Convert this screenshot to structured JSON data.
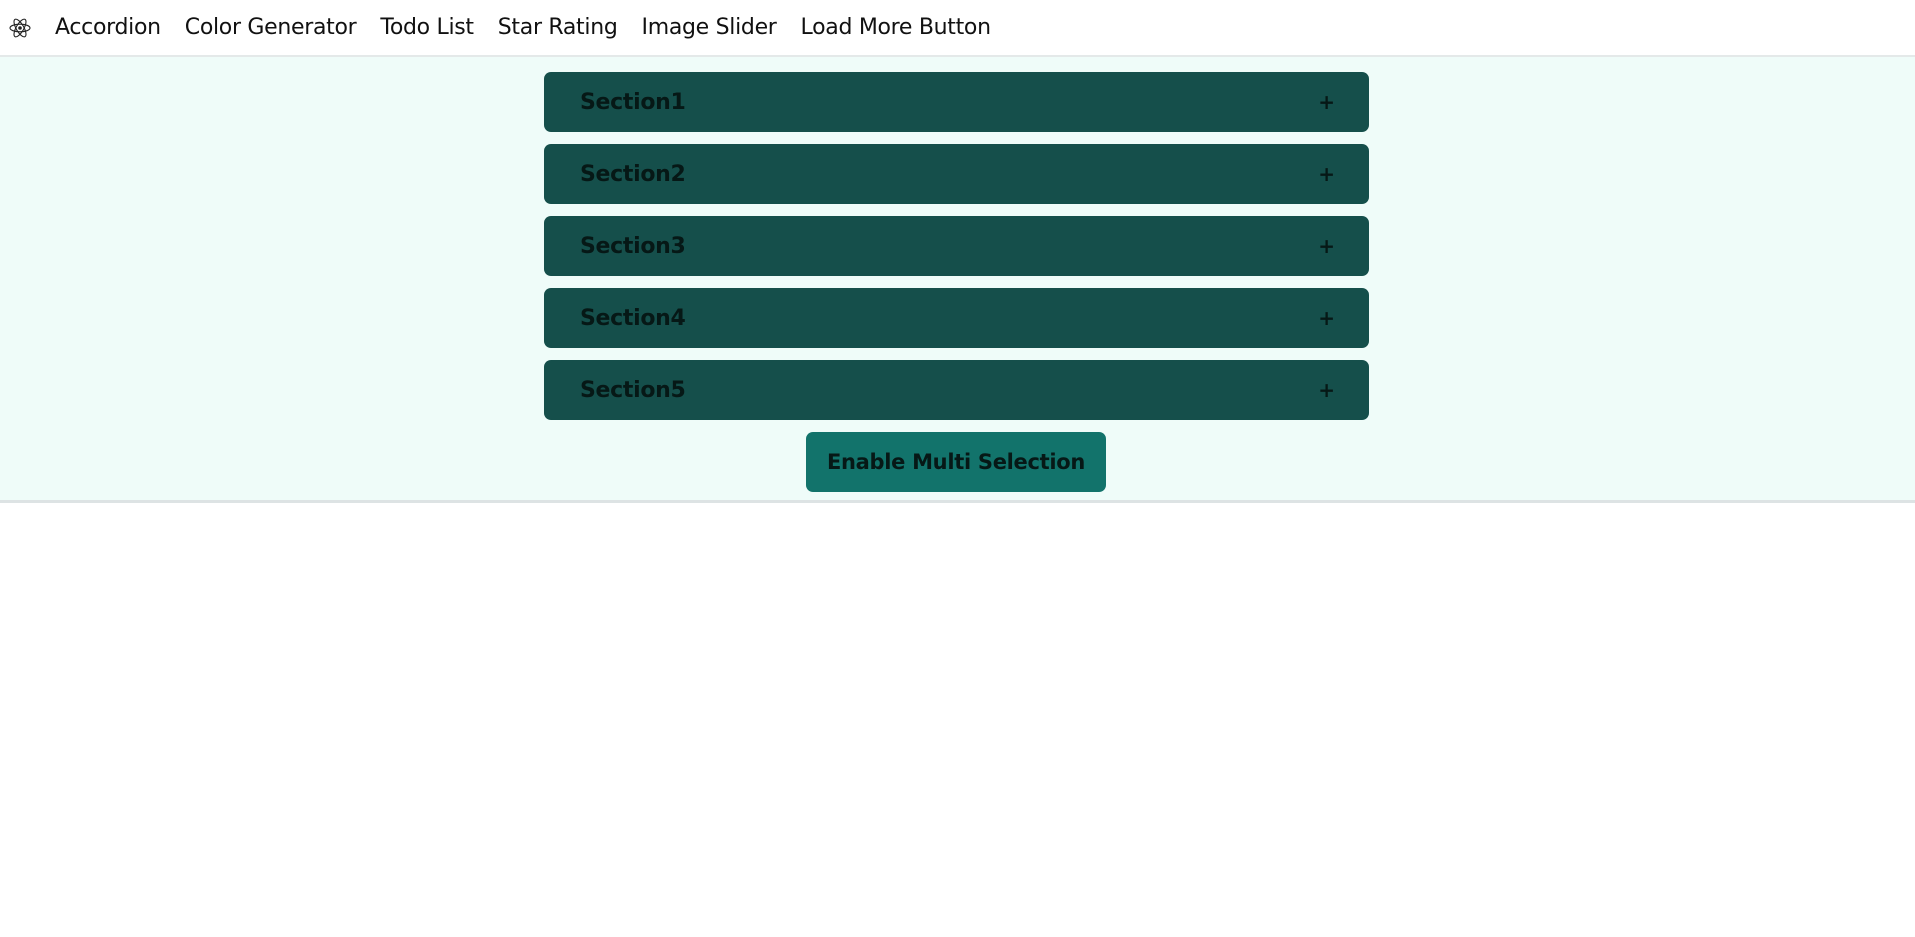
{
  "nav": {
    "logo_icon": "react-atom-icon",
    "links": [
      {
        "label": "Accordion"
      },
      {
        "label": "Color Generator"
      },
      {
        "label": "Todo List"
      },
      {
        "label": "Star Rating"
      },
      {
        "label": "Image Slider"
      },
      {
        "label": "Load More Button"
      }
    ]
  },
  "accordion": {
    "sections": [
      {
        "title": "Section1",
        "toggle": "+"
      },
      {
        "title": "Section2",
        "toggle": "+"
      },
      {
        "title": "Section3",
        "toggle": "+"
      },
      {
        "title": "Section4",
        "toggle": "+"
      },
      {
        "title": "Section5",
        "toggle": "+"
      }
    ],
    "multi_selection_label": "Enable Multi Selection"
  },
  "colors": {
    "page_background": "#effcf9",
    "section_background": "#154f4b",
    "button_background": "#12736b",
    "text_dark": "#061816"
  }
}
